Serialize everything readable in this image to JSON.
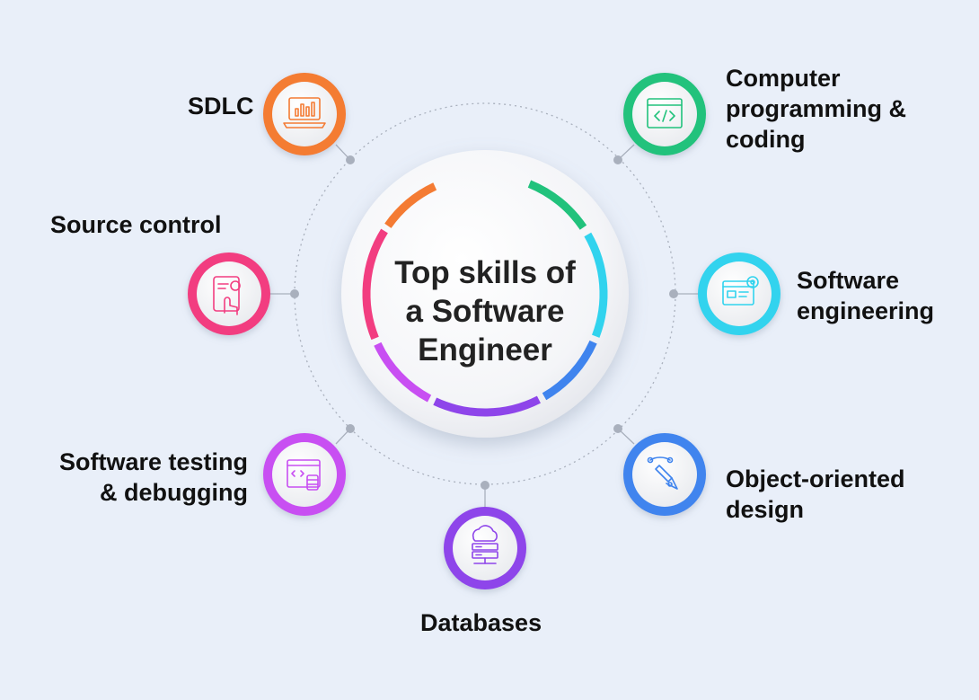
{
  "center": {
    "title": "Top skills of\na Software\nEngineer"
  },
  "skills": [
    {
      "id": "sdlc",
      "label": "SDLC",
      "color": "#f47b33",
      "icon": "laptop-chart-icon"
    },
    {
      "id": "computer-programming",
      "label": "Computer\nprogramming &\ncoding",
      "color": "#21c27c",
      "icon": "code-window-icon"
    },
    {
      "id": "source-control",
      "label": "Source control",
      "color": "#f23d80",
      "icon": "tablet-touch-gear-icon"
    },
    {
      "id": "software-engineering",
      "label": "Software\nengineering",
      "color": "#31d3ee",
      "icon": "browser-gear-icon"
    },
    {
      "id": "software-testing",
      "label": "Software testing\n& debugging",
      "color": "#c84ff2",
      "icon": "code-bug-window-icon"
    },
    {
      "id": "object-oriented-design",
      "label": "Object-oriented\ndesign",
      "color": "#3f84ee",
      "icon": "pen-tool-icon"
    },
    {
      "id": "databases",
      "label": "Databases",
      "color": "#8e45ea",
      "icon": "cloud-server-icon"
    }
  ]
}
